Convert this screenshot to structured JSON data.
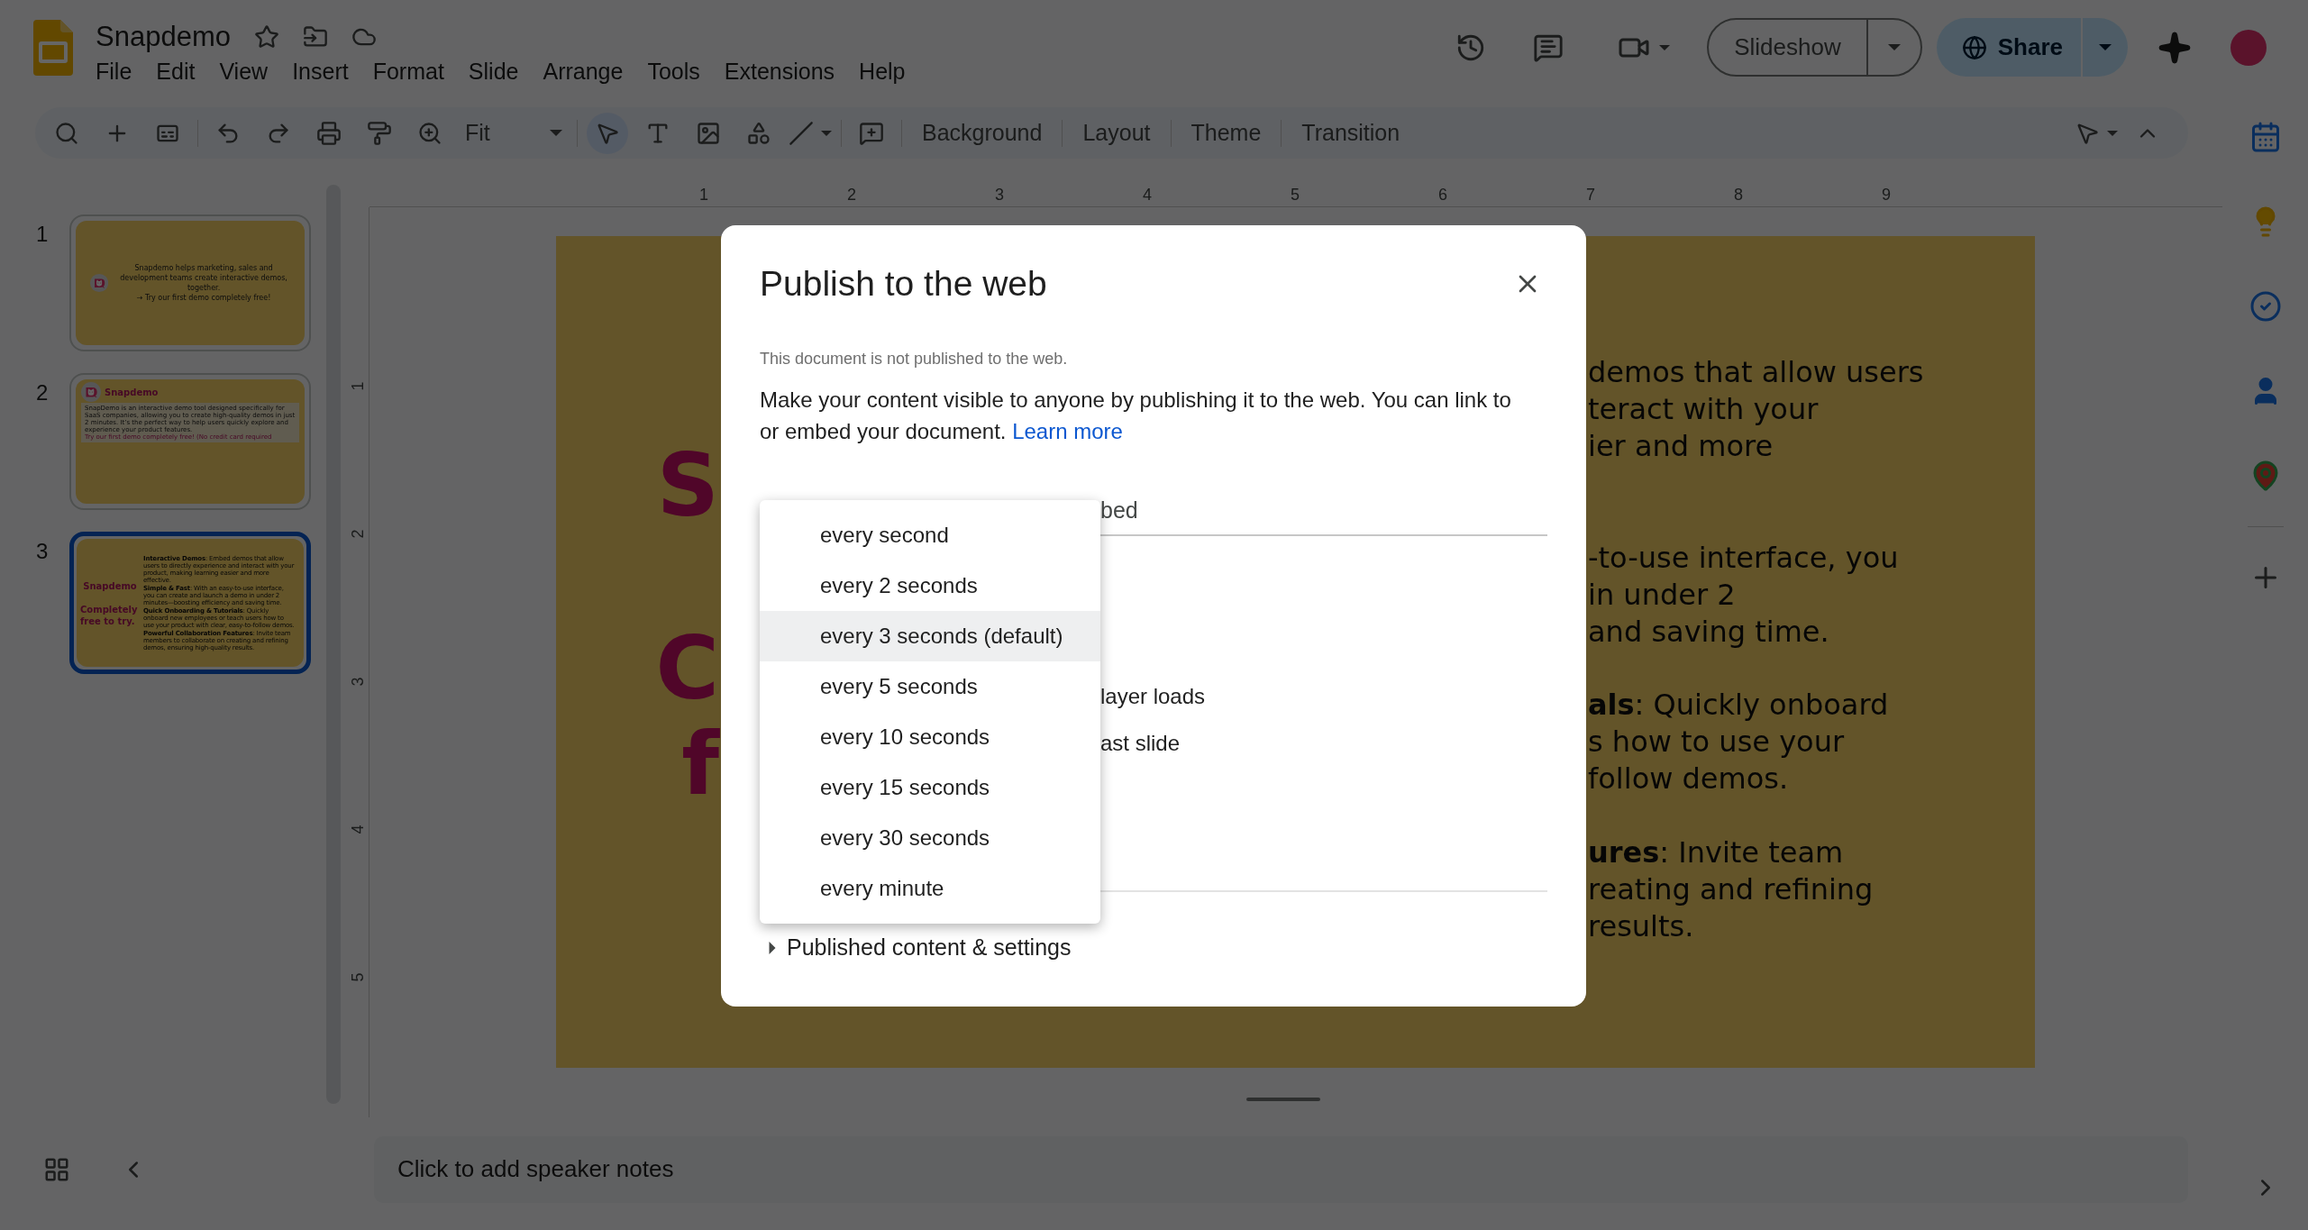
{
  "document": {
    "title": "Snapdemo"
  },
  "menu": [
    "File",
    "Edit",
    "View",
    "Insert",
    "Format",
    "Slide",
    "Arrange",
    "Tools",
    "Extensions",
    "Help"
  ],
  "header": {
    "slideshow": "Slideshow",
    "share": "Share"
  },
  "toolbar": {
    "zoom": "Fit",
    "buttons": [
      "Background",
      "Layout",
      "Theme",
      "Transition"
    ]
  },
  "slides": [
    {
      "number": "1",
      "selected": false,
      "kind": "title",
      "tagline": "Snapdemo helps marketing, sales and development teams create interactive demos, together.",
      "cta": "→  Try our first demo completely free!"
    },
    {
      "number": "2",
      "selected": false,
      "kind": "intro",
      "brand": "Snapdemo",
      "body": "SnapDemo is an interactive demo tool designed specifically for SaaS companies, allowing you to create high-quality demos in just 2 minutes. It’s the perfect way to help users quickly explore and experience your product features.",
      "cta": "Try our first demo completely free!",
      "cta_note": "(No credit card required"
    },
    {
      "number": "3",
      "selected": true,
      "kind": "features",
      "brand": "Snapdemo",
      "headline": "Completely free to try.",
      "features": [
        "**Interactive Demos**: Embed demos that allow users to directly experience and interact with your product, making learning easier and more effective.",
        "**Simple & Fast**: With an easy-to-use interface, you can create and launch a demo in under 2 minutes—boosting efficiency and saving time.",
        "**Quick Onboarding & Tutorials**: Quickly onboard new employees or teach users how to use your product with clear, easy-to-follow demos.",
        "**Powerful Collaboration Features**: Invite team members to collaborate on creating and refining demos, ensuring high-quality results."
      ]
    }
  ],
  "rulers": {
    "horizontal": [
      "1",
      "2",
      "3",
      "4",
      "5",
      "6",
      "7",
      "8",
      "9"
    ],
    "vertical": [
      "1",
      "2",
      "3",
      "4",
      "5"
    ]
  },
  "current_slide": {
    "left_fragments": [
      "S",
      "C",
      "f"
    ],
    "right_groups": [
      [
        "demos that allow users",
        "teract with your",
        "ier and more"
      ],
      [
        "-to-use interface, you",
        "in under 2",
        "and saving time."
      ],
      [
        "**als**: Quickly onboard",
        "s how to use your",
        "follow demos."
      ],
      [
        "**ures**: Invite team",
        "reating and refining",
        "results."
      ]
    ]
  },
  "speaker_notes": {
    "placeholder": "Click to add speaker notes"
  },
  "dialog": {
    "title": "Publish to the web",
    "status": "This document is not published to the web.",
    "description": "Make your content visible to anyone by publishing it to the web. You can link to or embed your document.",
    "learn_more": "Learn more",
    "tab_fragment": "bed",
    "option_fragments": [
      "layer loads",
      "ast slide"
    ],
    "published_settings": "Published content & settings",
    "interval_options": [
      {
        "label": "every second",
        "selected": false
      },
      {
        "label": "every 2 seconds",
        "selected": false
      },
      {
        "label": "every 3 seconds (default)",
        "selected": true
      },
      {
        "label": "every 5 seconds",
        "selected": false
      },
      {
        "label": "every 10 seconds",
        "selected": false
      },
      {
        "label": "every 15 seconds",
        "selected": false
      },
      {
        "label": "every 30 seconds",
        "selected": false
      },
      {
        "label": "every minute",
        "selected": false
      }
    ]
  }
}
